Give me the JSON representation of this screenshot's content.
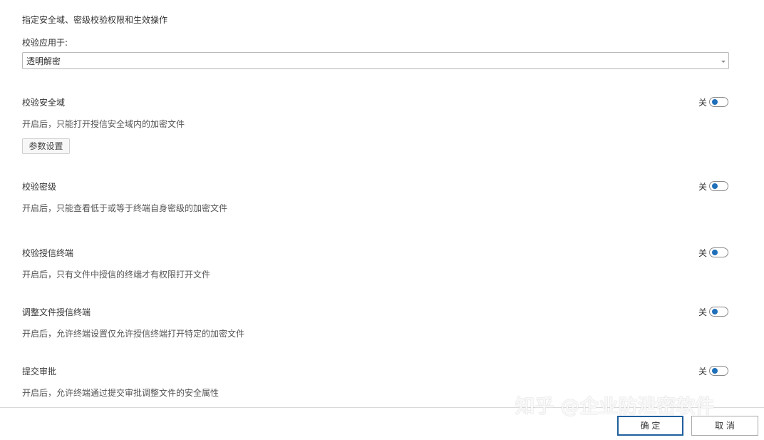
{
  "header": {
    "instruction": "指定安全域、密级校验权限和生效操作"
  },
  "apply": {
    "label": "校验应用于:",
    "selected": "透明解密"
  },
  "sections": [
    {
      "title": "校验安全域",
      "description": "开启后，只能打开授信安全域内的加密文件",
      "toggle_label": "关",
      "enabled": false,
      "button": "参数设置"
    },
    {
      "title": "校验密级",
      "description": "开启后，只能查看低于或等于终端自身密级的加密文件",
      "toggle_label": "关",
      "enabled": false
    },
    {
      "title": "校验授信终端",
      "description": "开启后，只有文件中授信的终端才有权限打开文件",
      "toggle_label": "关",
      "enabled": false
    },
    {
      "title": "调整文件授信终端",
      "description": "开启后，允许终端设置仅允许授信终端打开特定的加密文件",
      "toggle_label": "关",
      "enabled": false
    },
    {
      "title": "提交审批",
      "description": "开启后，允许终端通过提交审批调整文件的安全属性",
      "toggle_label": "关",
      "enabled": false
    }
  ],
  "footer": {
    "ok_label": "确 定",
    "cancel_label": "取 消"
  },
  "watermark": "知乎 @企业防泄密软件",
  "colors": {
    "toggle_knob": "#1f6fb9",
    "primary_border": "#1f5f9e"
  }
}
